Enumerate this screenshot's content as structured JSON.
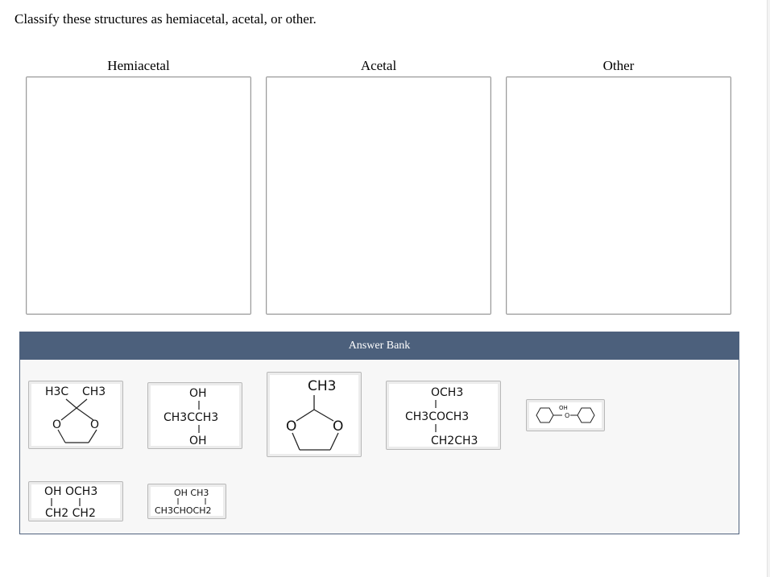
{
  "prompt": "Classify these structures as hemiacetal, acetal, or other.",
  "bins": [
    {
      "label": "Hemiacetal"
    },
    {
      "label": "Acetal"
    },
    {
      "label": "Other"
    }
  ],
  "answer_bank": {
    "header": "Answer Bank",
    "tiles": [
      {
        "name": "dioxolane-dimethyl",
        "labels": {
          "top_left": "H3C",
          "top_right": "CH3",
          "ring_o_left": "O",
          "ring_o_right": "O"
        }
      },
      {
        "name": "dihydroxy-propane",
        "labels": {
          "top": "OH",
          "middle": "CH3CCH3",
          "bottom": "OH"
        }
      },
      {
        "name": "dioxolane-methyl",
        "labels": {
          "top": "CH3",
          "ring_o_left": "O",
          "ring_o_right": "O"
        }
      },
      {
        "name": "dimethoxy-butane",
        "labels": {
          "top": "OCH3",
          "middle": "CH3COCH3",
          "bottom": "CH2CH3"
        }
      },
      {
        "name": "phenyl-hemiacetal",
        "labels": {
          "top": "OH",
          "bridge": "O"
        }
      },
      {
        "name": "hydroxy-methoxy-ethane",
        "labels": {
          "top": "OH OCH3",
          "bottom": "CH2 CH2"
        }
      },
      {
        "name": "hydroxy-methyl-ether",
        "labels": {
          "top": "OH CH3",
          "bottom": "CH3CHOCH2"
        }
      }
    ]
  }
}
